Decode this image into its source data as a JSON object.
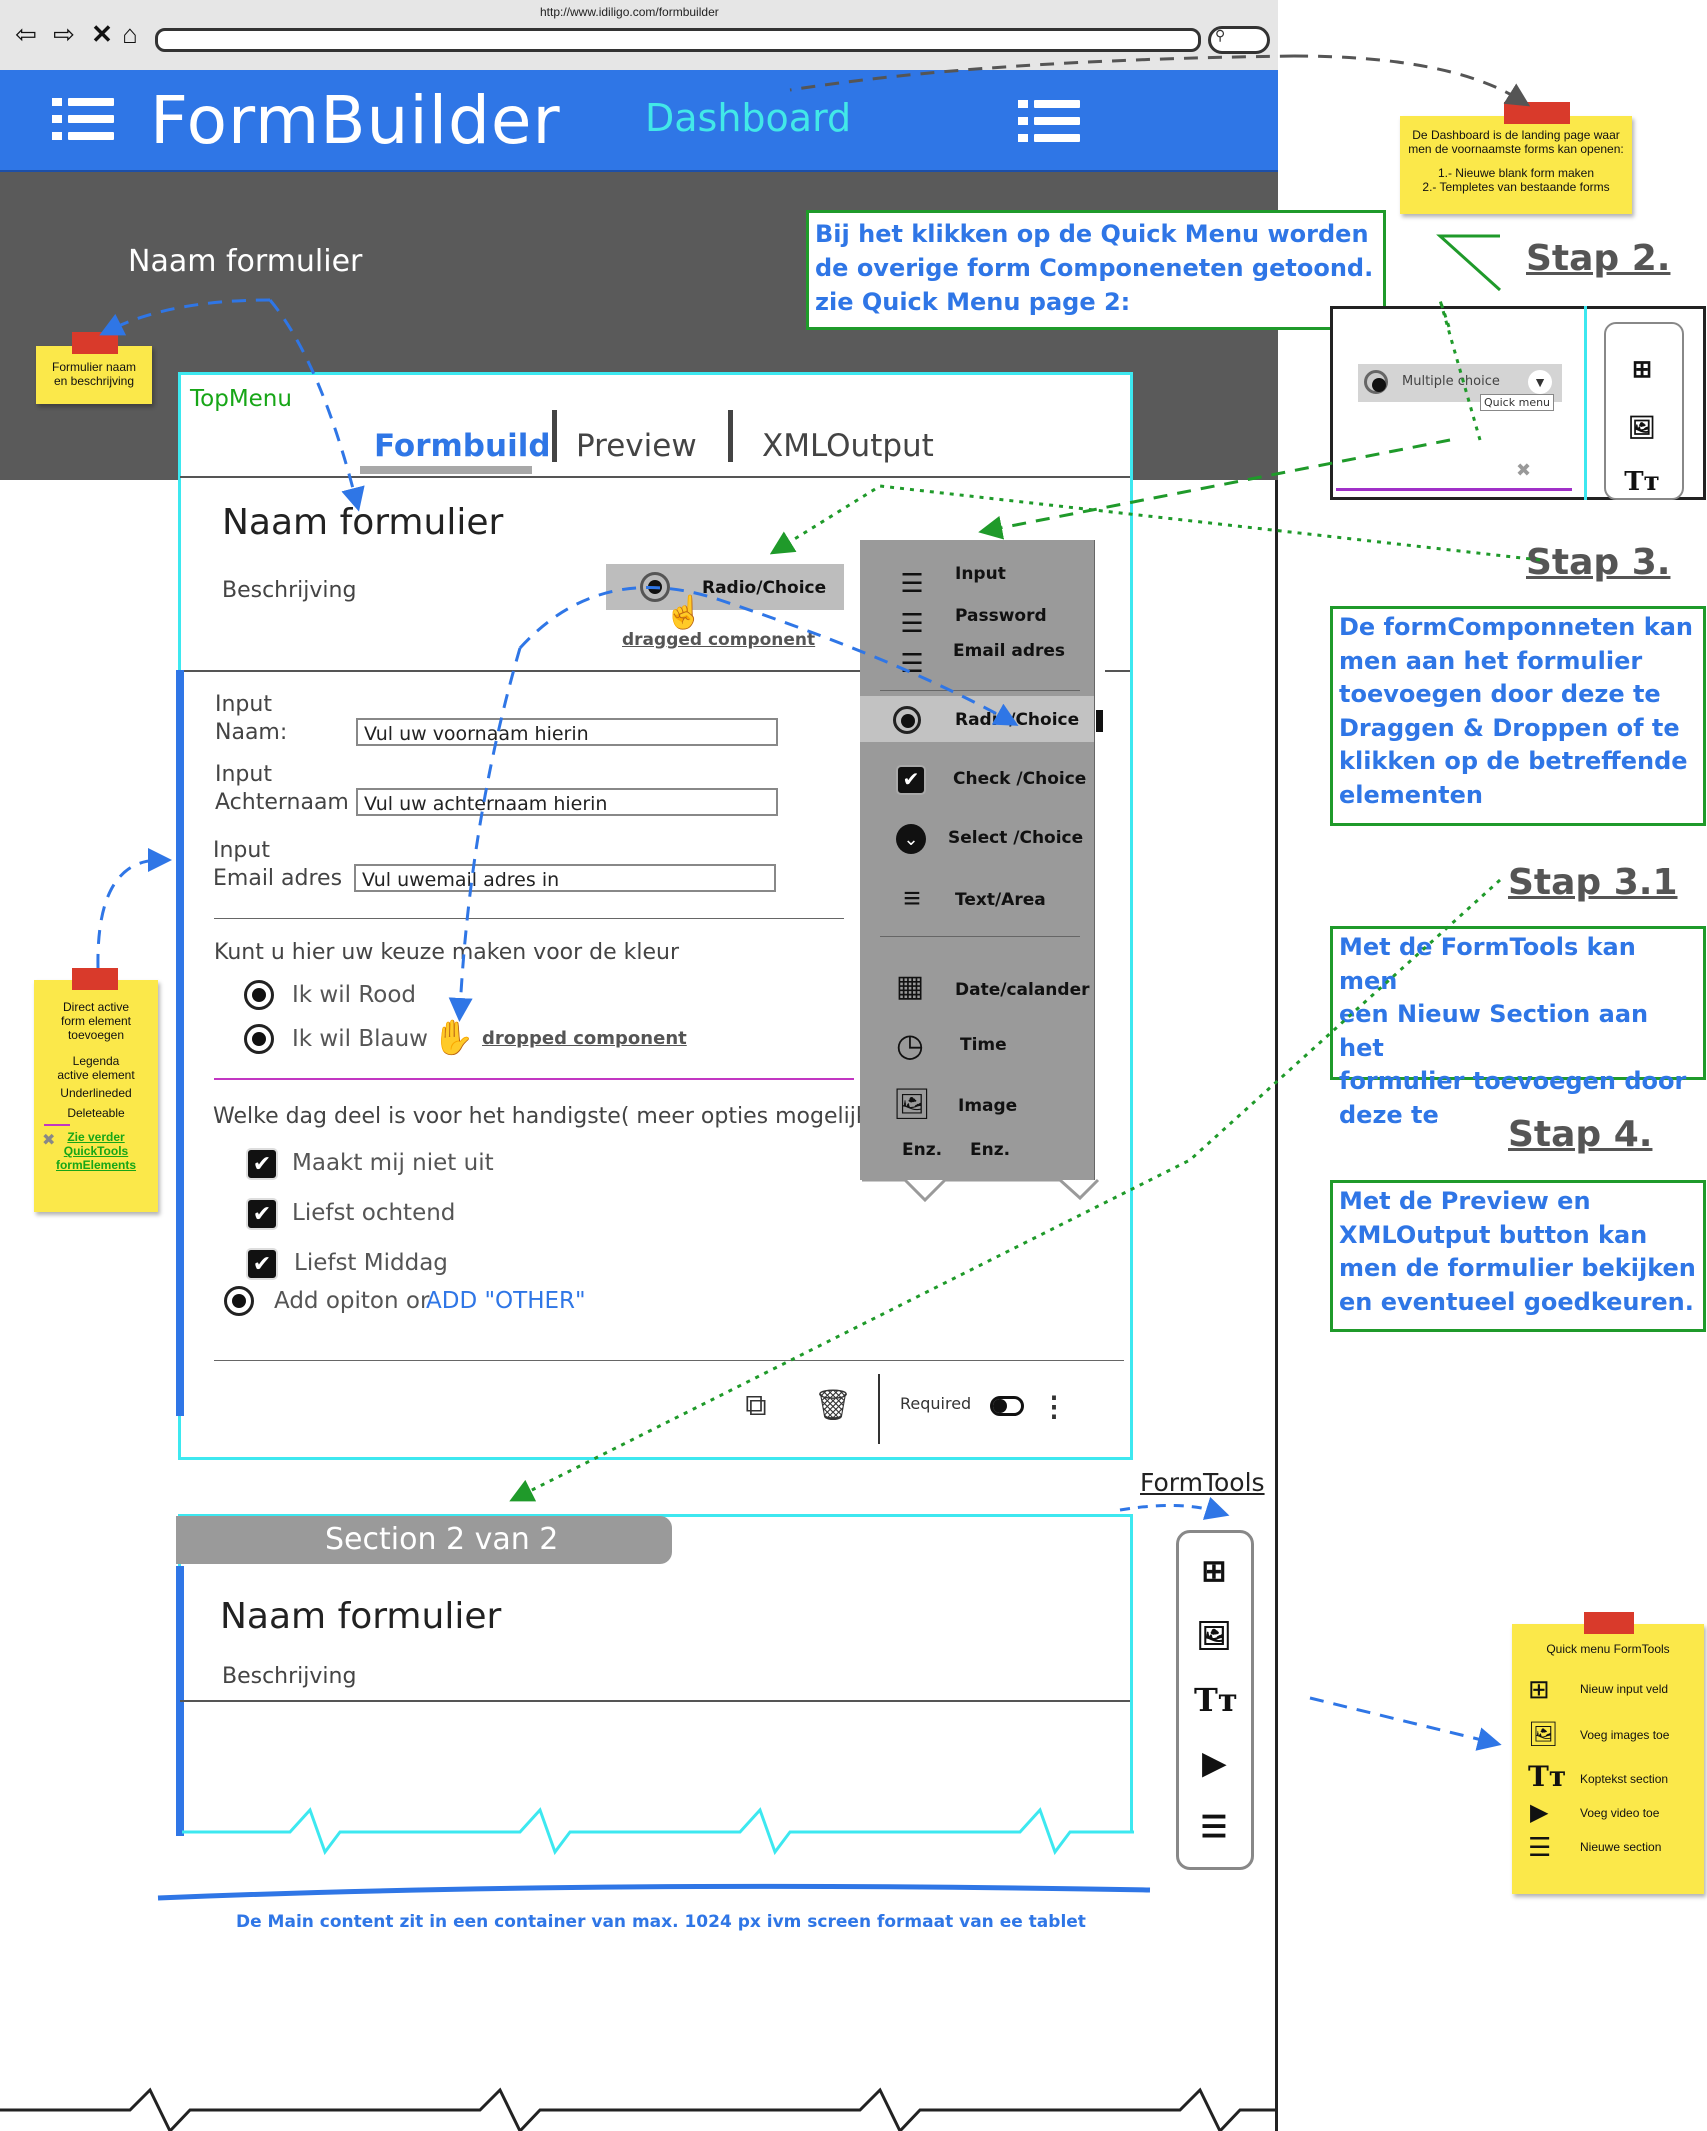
{
  "browser": {
    "url": "http://www.idiligo.com/formbuilder"
  },
  "header": {
    "brand": "FormBuilder",
    "dashboard": "Dashboard"
  },
  "hero": {
    "title": "Naam formulier"
  },
  "topmenu": {
    "label": "TopMenu",
    "tabs": [
      {
        "label": "Formbuild"
      },
      {
        "label": "Preview"
      },
      {
        "label": "XMLOutput"
      }
    ]
  },
  "form": {
    "title": "Naam formulier",
    "description": "Beschrijving",
    "dragged": {
      "chip": "Radio/Choice",
      "caption": "dragged component"
    },
    "fields": [
      {
        "label1": "Input",
        "label2": "Naam:",
        "value": "Vul uw voornaam hierin"
      },
      {
        "label1": "Input",
        "label2": "Achternaam",
        "value": "Vul uw achternaam hierin"
      },
      {
        "label1": "Input",
        "label2": "Email adres",
        "value": "Vul uwemail adres in"
      }
    ],
    "radio_question": "Kunt u hier uw keuze maken voor de kleur",
    "radio_options": [
      "Ik wil Rood",
      "Ik wil Blauw"
    ],
    "dropped_caption": "dropped component",
    "check_question": "Welke dag deel is voor het handigste( meer opties mogelijk)",
    "check_options": [
      "Maakt mij niet uit",
      "Liefst ochtend",
      "Liefst Middag"
    ],
    "add_option": "Add opiton or",
    "add_other": "ADD \"OTHER\"",
    "footer": {
      "required": "Required"
    }
  },
  "quick_menu": {
    "items": [
      "Input",
      "Password",
      "Email adres",
      "Radio/Choice",
      "Check /Choice",
      "Select /Choice",
      "Text/Area",
      "Date/calander",
      "Time",
      "Image"
    ],
    "enz1": "Enz.",
    "enz2": "Enz."
  },
  "section2": {
    "header": "Section 2 van 2",
    "title": "Naam formulier",
    "description": "Beschrijving"
  },
  "formtools": {
    "label": "FormTools"
  },
  "footer_note": "De Main content zit in een container van max. 1024 px ivm screen formaat van ee tablet",
  "notes": {
    "dashboard_note": {
      "line1": "De Dashboard is de landing page waar",
      "line2": "men de voornaamste forms kan openen:",
      "line3": "1.- Nieuwe blank form maken",
      "line4": "2.- Templetes van bestaande forms"
    },
    "name_note": {
      "line1": "Formulier naam",
      "line2": "en beschrijving"
    },
    "legend_note": {
      "line1": "Direct active",
      "line2": "form element",
      "line3": "toevoegen",
      "line4": "Legenda",
      "line5": "active element",
      "line6": "Underlineded",
      "line7": "Deleteable",
      "link1": "Zie verder",
      "link2": "QuickTools",
      "link3": "formElements"
    },
    "qm_formtools_note": {
      "title": "Quick menu FormTools",
      "items": [
        "Nieuw input veld",
        "Voeg images toe",
        "Koptekst section",
        "Voeg video toe",
        "Nieuwe section"
      ]
    }
  },
  "annotations": {
    "quickmenu_box": {
      "line1": "Bij het klikken op de Quick Menu worden",
      "line2": "de overige form Componeneten getoond.",
      "line3": "zie Quick Menu page 2:"
    },
    "stap2": "Stap 2.",
    "stap2_mini": {
      "select": "Multiple choice",
      "tooltip": "Quick menu"
    },
    "stap3": "Stap 3.",
    "stap3_text": {
      "line1": "De formComponneten kan",
      "line2": "men aan het formulier",
      "line3": "toevoegen door deze te",
      "line4": "Draggen & Droppen of te",
      "line5": "klikken op de betreffende",
      "line6": "elementen"
    },
    "stap31": "Stap 3.1",
    "stap31_text": {
      "line1": "Met de FormTools kan men",
      "line2": "een Nieuw Section aan het",
      "line3": "formulier toevoegen door",
      "line4": "deze te"
    },
    "stap4": "Stap 4.",
    "stap4_text": {
      "line1": "Met de Preview en",
      "line2": "XMLOutput button kan",
      "line3": "men de formulier bekijken",
      "line4": "en eventueel goedkeuren."
    }
  },
  "colors": {
    "brand_blue": "#2f76e6",
    "cyan": "#3de8f0",
    "note_yellow": "#fbe84a",
    "green": "#1f9a2a",
    "dark_band": "#5a5a5a"
  }
}
